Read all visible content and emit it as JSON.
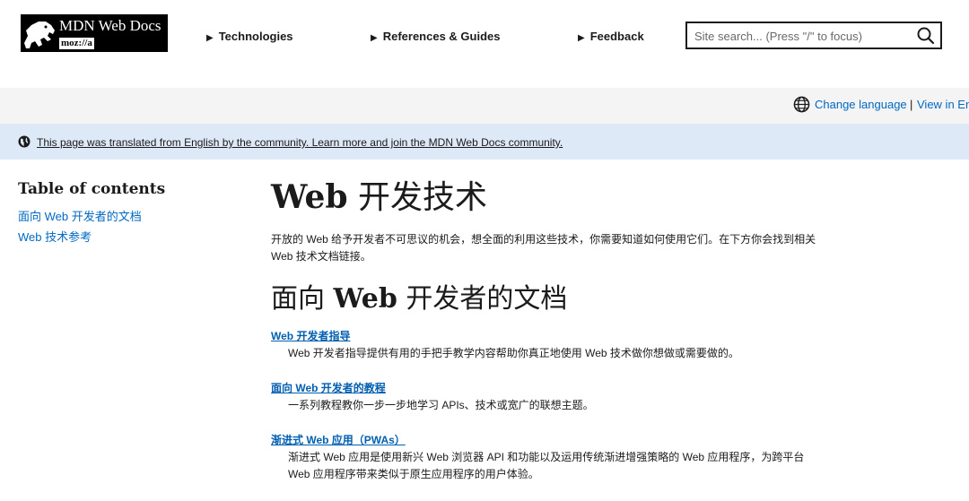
{
  "header": {
    "logo_title": "MDN Web Docs",
    "logo_sub": "moz://a",
    "nav": [
      {
        "label": "Technologies",
        "icon": "triangle-right-icon"
      },
      {
        "label": "References & Guides",
        "icon": "triangle-right-icon"
      },
      {
        "label": "Feedback",
        "icon": "triangle-right-icon"
      }
    ],
    "search_placeholder": "Site search... (Press \"/\" to focus)"
  },
  "language_bar": {
    "change_language": "Change language",
    "separator": "|",
    "view_english": "View in En"
  },
  "notice": {
    "text": "This page was translated from English by the community. Learn more and join the MDN Web Docs community."
  },
  "toc": {
    "title": "Table of contents",
    "items": [
      "面向 Web 开发者的文档",
      "Web 技术参考"
    ]
  },
  "main": {
    "title_en": "Web",
    "title_zh": " 开发技术",
    "intro": "开放的 Web 给予开发者不可思议的机会，想全面的利用这些技术，你需要知道如何使用它们。在下方你会找到相关 Web 技术文档链接。",
    "section_en": "Web",
    "section_pre": "面向 ",
    "section_post": " 开发者的文档",
    "entries": [
      {
        "term": "Web 开发者指导",
        "desc": "Web 开发者指导提供有用的手把手教学内容帮助你真正地使用 Web 技术做你想做或需要做的。"
      },
      {
        "term": "面向 Web 开发者的教程",
        "desc": "一系列教程教你一步一步地学习 APIs、技术或宽广的联想主题。"
      },
      {
        "term": "渐进式 Web 应用（PWAs）",
        "desc": "渐进式 Web 应用是使用新兴 Web 浏览器 API 和功能以及运用传统渐进增强策略的 Web 应用程序，为跨平台 Web 应用程序带来类似于原生应用程序的用户体验。"
      }
    ]
  },
  "colors": {
    "link": "#0069c2",
    "notice_bg": "#dee9f8",
    "langbar_bg": "#f4f4f4"
  }
}
